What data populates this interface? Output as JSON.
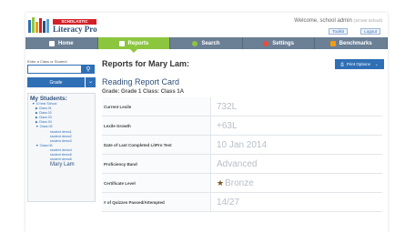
{
  "header": {
    "brand_top": "SCHOLASTIC",
    "brand_name": "Literacy Pro",
    "welcome": "Welcome, school admin",
    "welcome_school": "(10 test School)",
    "btn_toolkit": "Toolkit",
    "btn_logout": "Logout"
  },
  "nav": {
    "items": [
      {
        "label": "Home",
        "icon": "home-icon"
      },
      {
        "label": "Reports",
        "icon": "reports-icon"
      },
      {
        "label": "Search",
        "icon": "search-icon"
      },
      {
        "label": "Settings",
        "icon": "gear-icon"
      },
      {
        "label": "Benchmarks",
        "icon": "benchmarks-icon"
      }
    ],
    "active": "Reports"
  },
  "sidebar": {
    "search_label": "Enter a Class or Student",
    "search_placeholder": "",
    "grade_label": "Grade",
    "students_title": "My Students:",
    "tree": {
      "school": "10 test School",
      "classes": [
        "Class 01",
        "Class 02",
        "Class 03",
        "Class 04"
      ],
      "class05": "Class 05",
      "class05_students": [
        "student demo1",
        "student demo2",
        "student demo3"
      ],
      "class06": "Class 06",
      "class06_students": [
        "student demo4",
        "student demo5",
        "student demo6"
      ],
      "selected_student": "Mary Lam"
    }
  },
  "main": {
    "title": "Reports for Mary Lam:",
    "print_label": "Print Options",
    "subtitle": "Reading Report Card",
    "grade_line": "Grade: Grade 1   Class: Class 1A",
    "rows": [
      {
        "label": "Current Lexile",
        "value": "732L"
      },
      {
        "label": "Lexile Growth",
        "value": "+63L"
      },
      {
        "label": "Date of Last Completed LitPro Test",
        "value": "10 Jan 2014"
      },
      {
        "label": "Proficiency Band",
        "value": "Advanced"
      },
      {
        "label": "Certificate Level",
        "value": "Bronze"
      },
      {
        "label": "# of Quizzes Passed/Attempted",
        "value": "14/27"
      }
    ]
  },
  "colors": {
    "accent_blue": "#2f6fb5",
    "nav_bg": "#6b7f95",
    "active_green": "#8cc63f",
    "brand_red": "#d32027"
  }
}
